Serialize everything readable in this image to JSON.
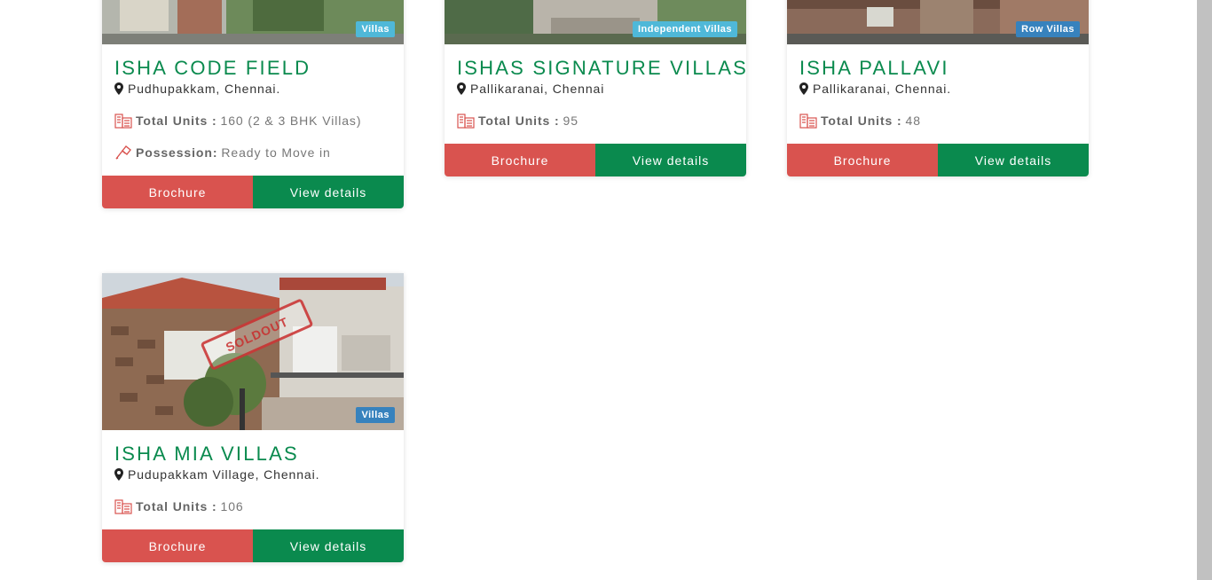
{
  "colors": {
    "brand_green": "#0a8a4e",
    "brochure_red": "#d9534f",
    "tag_light": "#4fb8d8",
    "tag_dark": "#3782bd"
  },
  "icons": {
    "location": "map-marker-icon",
    "units": "building-icon",
    "possession": "key-icon"
  },
  "labels": {
    "total_units": "Total Units :",
    "possession": "Possession:",
    "brochure": "Brochure",
    "view_details": "View details"
  },
  "cards": [
    {
      "title": "ISHA CODE FIELD",
      "location": "Pudhupakkam, Chennai.",
      "tag": "Villas",
      "units": "160 (2 & 3 BHK Villas)",
      "possession": "Ready to Move in"
    },
    {
      "title": "ISHAS SIGNATURE VILLAS",
      "location": "Pallikaranai, Chennai",
      "tag": "Independent Villas",
      "units": "95"
    },
    {
      "title": "ISHA PALLAVI",
      "location": "Pallikaranai, Chennai.",
      "tag": "Row Villas",
      "units": "48"
    },
    {
      "title": "ISHA MIA VILLAS",
      "location": "Pudupakkam Village, Chennai.",
      "tag": "Villas",
      "units": "106",
      "stamp": "SOLDOUT"
    }
  ]
}
